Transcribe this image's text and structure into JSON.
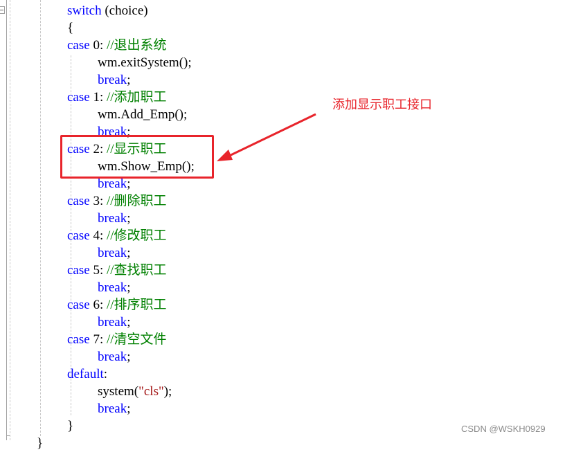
{
  "editor": {
    "lines": [
      {
        "indent": 1,
        "tokens": [
          {
            "t": "switch",
            "c": "kw"
          },
          {
            "t": " (choice)",
            "c": ""
          }
        ]
      },
      {
        "indent": 1,
        "tokens": [
          {
            "t": "{",
            "c": ""
          }
        ]
      },
      {
        "indent": 1,
        "tokens": [
          {
            "t": "case",
            "c": "kw"
          },
          {
            "t": " 0: ",
            "c": ""
          },
          {
            "t": "//退出系统",
            "c": "cm"
          }
        ]
      },
      {
        "indent": 2,
        "tokens": [
          {
            "t": "wm.exitSystem();",
            "c": ""
          }
        ]
      },
      {
        "indent": 2,
        "tokens": [
          {
            "t": "break",
            "c": "kw"
          },
          {
            "t": ";",
            "c": ""
          }
        ]
      },
      {
        "indent": 1,
        "tokens": [
          {
            "t": "case",
            "c": "kw"
          },
          {
            "t": " 1: ",
            "c": ""
          },
          {
            "t": "//添加职工",
            "c": "cm"
          }
        ]
      },
      {
        "indent": 2,
        "tokens": [
          {
            "t": "wm.Add_Emp();",
            "c": ""
          }
        ]
      },
      {
        "indent": 2,
        "tokens": [
          {
            "t": "break",
            "c": "kw"
          },
          {
            "t": ";",
            "c": ""
          }
        ]
      },
      {
        "indent": 1,
        "tokens": [
          {
            "t": "case",
            "c": "kw"
          },
          {
            "t": " 2: ",
            "c": ""
          },
          {
            "t": "//显示职工",
            "c": "cm"
          }
        ]
      },
      {
        "indent": 2,
        "tokens": [
          {
            "t": "wm.Show_Emp();",
            "c": ""
          }
        ]
      },
      {
        "indent": 2,
        "tokens": [
          {
            "t": "break",
            "c": "kw"
          },
          {
            "t": ";",
            "c": ""
          }
        ]
      },
      {
        "indent": 1,
        "tokens": [
          {
            "t": "case",
            "c": "kw"
          },
          {
            "t": " 3: ",
            "c": ""
          },
          {
            "t": "//删除职工",
            "c": "cm"
          }
        ]
      },
      {
        "indent": 2,
        "tokens": [
          {
            "t": "break",
            "c": "kw"
          },
          {
            "t": ";",
            "c": ""
          }
        ]
      },
      {
        "indent": 1,
        "tokens": [
          {
            "t": "case",
            "c": "kw"
          },
          {
            "t": " 4: ",
            "c": ""
          },
          {
            "t": "//修改职工",
            "c": "cm"
          }
        ]
      },
      {
        "indent": 2,
        "tokens": [
          {
            "t": "break",
            "c": "kw"
          },
          {
            "t": ";",
            "c": ""
          }
        ]
      },
      {
        "indent": 1,
        "tokens": [
          {
            "t": "case",
            "c": "kw"
          },
          {
            "t": " 5: ",
            "c": ""
          },
          {
            "t": "//查找职工",
            "c": "cm"
          }
        ]
      },
      {
        "indent": 2,
        "tokens": [
          {
            "t": "break",
            "c": "kw"
          },
          {
            "t": ";",
            "c": ""
          }
        ]
      },
      {
        "indent": 1,
        "tokens": [
          {
            "t": "case",
            "c": "kw"
          },
          {
            "t": " 6: ",
            "c": ""
          },
          {
            "t": "//排序职工",
            "c": "cm"
          }
        ]
      },
      {
        "indent": 2,
        "tokens": [
          {
            "t": "break",
            "c": "kw"
          },
          {
            "t": ";",
            "c": ""
          }
        ]
      },
      {
        "indent": 1,
        "tokens": [
          {
            "t": "case",
            "c": "kw"
          },
          {
            "t": " 7: ",
            "c": ""
          },
          {
            "t": "//清空文件",
            "c": "cm"
          }
        ]
      },
      {
        "indent": 2,
        "tokens": [
          {
            "t": "break",
            "c": "kw"
          },
          {
            "t": ";",
            "c": ""
          }
        ]
      },
      {
        "indent": 1,
        "tokens": [
          {
            "t": "default",
            "c": "kw"
          },
          {
            "t": ":",
            "c": ""
          }
        ]
      },
      {
        "indent": 2,
        "tokens": [
          {
            "t": "system(",
            "c": ""
          },
          {
            "t": "\"cls\"",
            "c": "str"
          },
          {
            "t": ");",
            "c": ""
          }
        ]
      },
      {
        "indent": 2,
        "tokens": [
          {
            "t": "break",
            "c": "kw"
          },
          {
            "t": ";",
            "c": ""
          }
        ]
      },
      {
        "indent": 1,
        "tokens": [
          {
            "t": "}",
            "c": ""
          }
        ]
      },
      {
        "indent": 0,
        "tokens": [
          {
            "t": "}",
            "c": ""
          }
        ]
      }
    ]
  },
  "annotation": {
    "text": "添加显示职工接口",
    "color": "#e8242b"
  },
  "watermark": "CSDN @WSKH0929",
  "colors": {
    "keyword": "#0000ff",
    "comment": "#008000",
    "string": "#a31515",
    "highlight": "#e8242b"
  }
}
